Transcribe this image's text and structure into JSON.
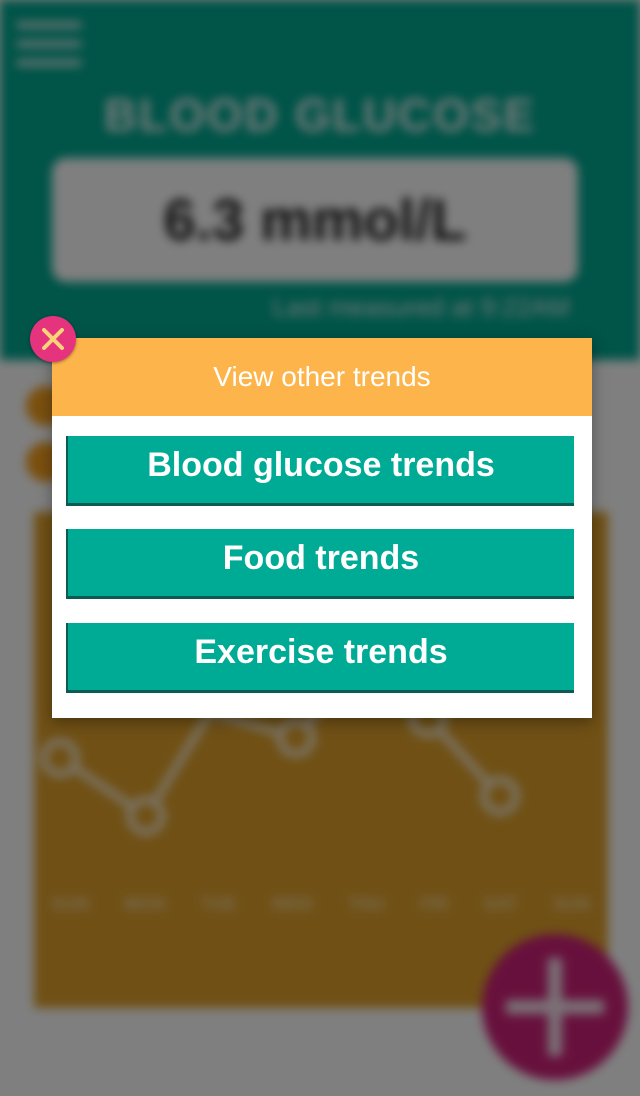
{
  "background": {
    "title": "BLOOD GLUCOSE",
    "reading": "6.3 mmol/L",
    "last_measured": "Last measured at 9:22AM",
    "days": [
      "SUN",
      "MON",
      "TUE",
      "WED",
      "THU",
      "FRI",
      "SAT",
      "SUN"
    ],
    "colors": {
      "header": "#00a891",
      "chart": "#e0a12a",
      "fab": "#d0217a"
    }
  },
  "modal": {
    "title": "View other trends",
    "buttons": {
      "blood_glucose": "Blood glucose trends",
      "food": "Food trends",
      "exercise": "Exercise trends"
    },
    "close_icon": "close-icon",
    "colors": {
      "header": "#fdb54b",
      "button": "#00ab96",
      "close": "#e6337e"
    }
  },
  "fab": {
    "icon": "plus-icon"
  }
}
